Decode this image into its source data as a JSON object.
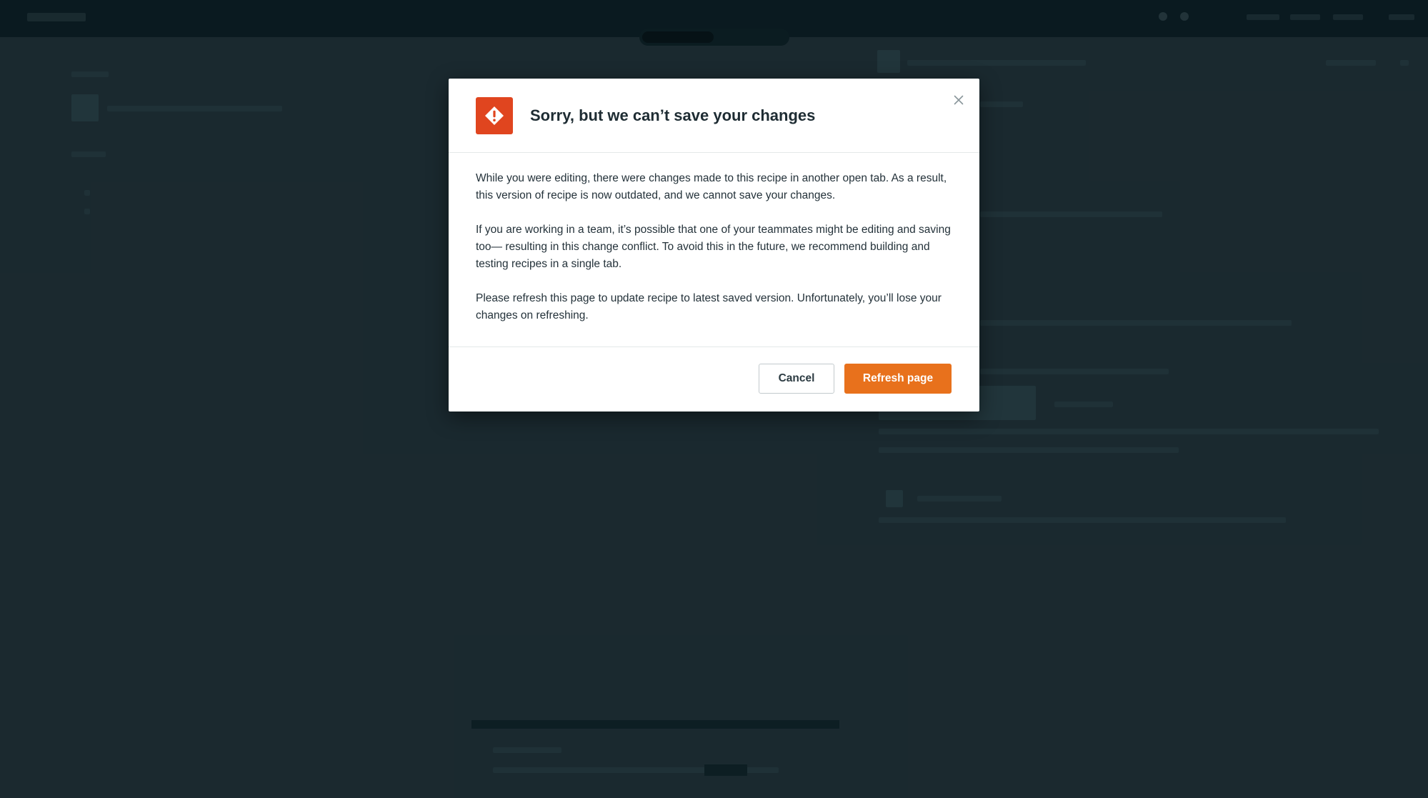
{
  "colors": {
    "overlay_background": "#1d2d33",
    "dialog_background": "#ffffff",
    "warning_badge": "#e0451f",
    "primary_button": "#e8711c",
    "title_text": "#1e2c33"
  },
  "dialog": {
    "icon": "warning-diamond-icon",
    "title": "Sorry, but we can’t save your changes",
    "close_icon": "close-icon",
    "paragraphs": [
      "While you were editing, there were changes made to this recipe in another open tab. As a result, this version of recipe is now outdated, and we cannot save your changes.",
      "If you are working in a team, it’s possible that one of your teammates might be editing and saving too— resulting in this change conflict. To avoid this in the future, we recommend building and testing recipes in a single tab.",
      "Please refresh this page to update recipe to latest saved version. Unfortunately, you’ll lose your changes on refreshing."
    ],
    "buttons": {
      "cancel": "Cancel",
      "refresh": "Refresh page"
    }
  }
}
